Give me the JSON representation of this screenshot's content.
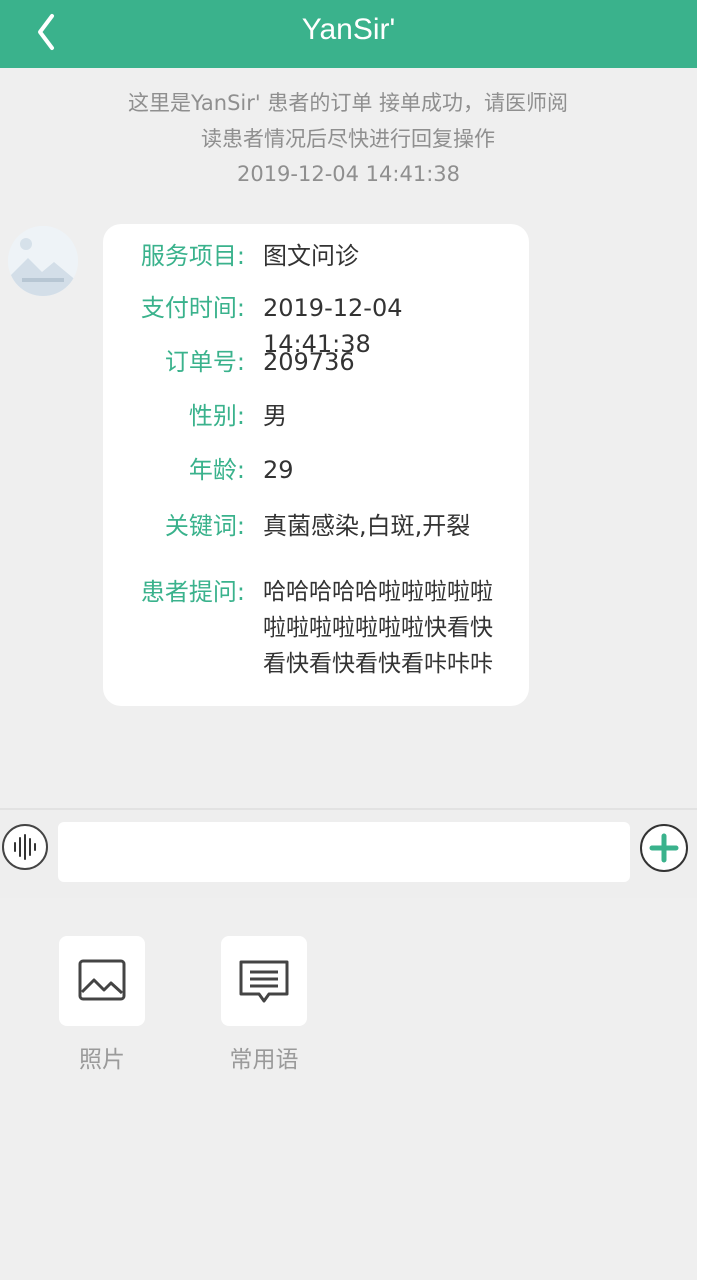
{
  "header": {
    "title": "YanSir'",
    "back_icon": "chevron-left-icon",
    "bg_color": "#3ab28c"
  },
  "notice": {
    "text": "这里是YanSir' 患者的订单 接单成功，请医师阅读患者情况后尽快进行回复操作",
    "time": "2019-12-04 14:41:38"
  },
  "order_card": {
    "rows": [
      {
        "label": "服务项目:",
        "value": "图文问诊"
      },
      {
        "label": "支付时间:",
        "value": "2019-12-04 14:41:38"
      },
      {
        "label": "订单号:",
        "value": "209736"
      },
      {
        "label": "性别:",
        "value": "男"
      },
      {
        "label": "年龄:",
        "value": "29"
      },
      {
        "label": "关键词:",
        "value": "真菌感染,白斑,开裂"
      },
      {
        "label": "患者提问:",
        "value": "哈哈哈哈哈啦啦啦啦啦啦啦啦啦啦啦啦快看快看快看快看快看咔咔咔"
      }
    ]
  },
  "input_bar": {
    "voice_icon": "voice-wave-icon",
    "placeholder": "",
    "plus_icon": "plus-circle-icon"
  },
  "tools": [
    {
      "label": "照片",
      "icon": "image-icon"
    },
    {
      "label": "常用语",
      "icon": "message-icon"
    }
  ]
}
